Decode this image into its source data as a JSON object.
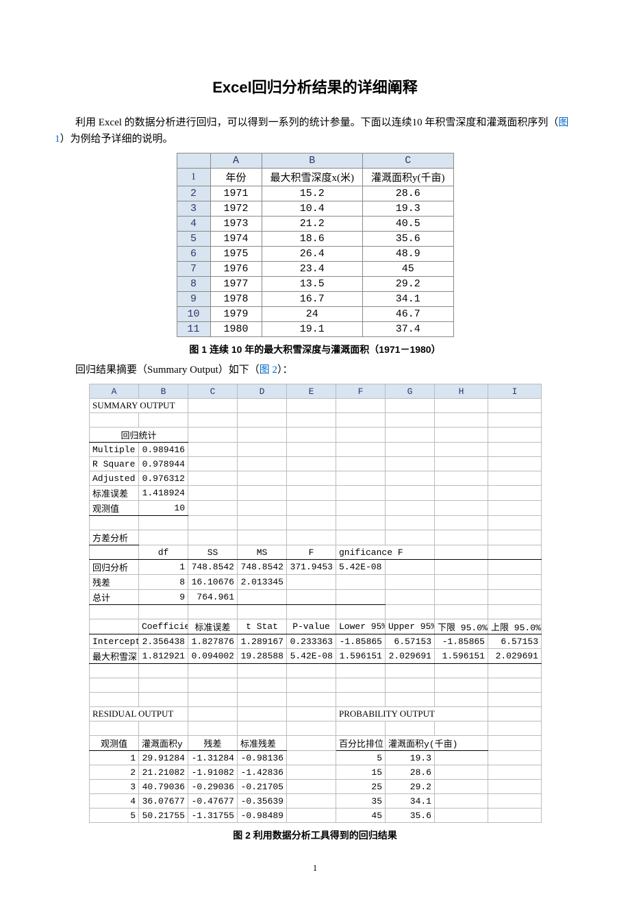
{
  "title": "Excel回归分析结果的详细阐释",
  "intro_pre": "利用 Excel 的数据分析进行回归，可以得到一系列的统计参量。下面以连续10 年积雪深度和灌溉面积序列（",
  "intro_link1": "图 1",
  "intro_post": "）为例给予详细的说明。",
  "table1": {
    "col_letters": [
      "A",
      "B",
      "C"
    ],
    "headers": [
      "年份",
      "最大积雪深度x(米)",
      "灌溉面积y(千亩)"
    ],
    "rows": [
      {
        "n": "1",
        "vals": [
          "年份",
          "最大积雪深度x(米)",
          "灌溉面积y(千亩)"
        ]
      },
      {
        "n": "2",
        "vals": [
          "1971",
          "15.2",
          "28.6"
        ]
      },
      {
        "n": "3",
        "vals": [
          "1972",
          "10.4",
          "19.3"
        ]
      },
      {
        "n": "4",
        "vals": [
          "1973",
          "21.2",
          "40.5"
        ]
      },
      {
        "n": "5",
        "vals": [
          "1974",
          "18.6",
          "35.6"
        ]
      },
      {
        "n": "6",
        "vals": [
          "1975",
          "26.4",
          "48.9"
        ]
      },
      {
        "n": "7",
        "vals": [
          "1976",
          "23.4",
          "45"
        ]
      },
      {
        "n": "8",
        "vals": [
          "1977",
          "13.5",
          "29.2"
        ]
      },
      {
        "n": "9",
        "vals": [
          "1978",
          "16.7",
          "34.1"
        ]
      },
      {
        "n": "10",
        "vals": [
          "1979",
          "24",
          "46.7"
        ]
      },
      {
        "n": "11",
        "vals": [
          "1980",
          "19.1",
          "37.4"
        ]
      }
    ]
  },
  "caption1": "图 1  连续 10 年的最大积雪深度与灌溉面积（1971－1980）",
  "summary_intro_pre": "回归结果摘要（Summary Output）如下（",
  "summary_intro_link": "图 2",
  "summary_intro_post": "）：",
  "sheet_cols": [
    "A",
    "B",
    "C",
    "D",
    "E",
    "F",
    "G",
    "H",
    "I"
  ],
  "summary_title": "SUMMARY OUTPUT",
  "reg_stat_title": "回归统计",
  "reg_stats": [
    {
      "label": "Multiple",
      "val": "0.989416"
    },
    {
      "label": "R Square",
      "val": "0.978944"
    },
    {
      "label": "Adjusted",
      "val": "0.976312"
    },
    {
      "label": "标准误差",
      "val": "1.418924"
    },
    {
      "label": "观测值",
      "val": "10"
    }
  ],
  "anova_title": "方差分析",
  "anova_headers": [
    "",
    "df",
    "SS",
    "MS",
    "F",
    "gnificance F",
    "",
    "",
    ""
  ],
  "anova_rows": [
    {
      "label": "回归分析",
      "df": "1",
      "ss": "748.8542",
      "ms": "748.8542",
      "f": "371.9453",
      "sig": "5.42E-08"
    },
    {
      "label": "残差",
      "df": "8",
      "ss": "16.10676",
      "ms": "2.013345",
      "f": "",
      "sig": ""
    },
    {
      "label": "总计",
      "df": "9",
      "ss": "764.961",
      "ms": "",
      "f": "",
      "sig": ""
    }
  ],
  "coef_headers": [
    "",
    "Coefficien",
    "标准误差",
    "t Stat",
    "P-value",
    "Lower 95%",
    "Upper 95%",
    "下限 95.0%",
    "上限 95.0%"
  ],
  "coef_rows": [
    {
      "label": "Intercept",
      "c": "2.356438",
      "se": "1.827876",
      "t": "1.289167",
      "p": "0.233363",
      "l95": "-1.85865",
      "u95": "6.57153",
      "l95b": "-1.85865",
      "u95b": "6.57153"
    },
    {
      "label": "最大积雪深",
      "c": "1.812921",
      "se": "0.094002",
      "t": "19.28588",
      "p": "5.42E-08",
      "l95": "1.596151",
      "u95": "2.029691",
      "l95b": "1.596151",
      "u95b": "2.029691"
    }
  ],
  "residual_title": "RESIDUAL OUTPUT",
  "probability_title": "PROBABILITY OUTPUT",
  "resid_headers_left": [
    "观测值",
    "灌溉面积y",
    "残差",
    "标准残差"
  ],
  "resid_headers_right": [
    "百分比排位",
    "灌溉面积y(千亩)"
  ],
  "resid_rows": [
    {
      "n": "1",
      "pred": "29.91284",
      "res": "-1.31284",
      "std": "-0.98136",
      "pct": "5",
      "y": "19.3"
    },
    {
      "n": "2",
      "pred": "21.21082",
      "res": "-1.91082",
      "std": "-1.42836",
      "pct": "15",
      "y": "28.6"
    },
    {
      "n": "3",
      "pred": "40.79036",
      "res": "-0.29036",
      "std": "-0.21705",
      "pct": "25",
      "y": "29.2"
    },
    {
      "n": "4",
      "pred": "36.07677",
      "res": "-0.47677",
      "std": "-0.35639",
      "pct": "35",
      "y": "34.1"
    },
    {
      "n": "5",
      "pred": "50.21755",
      "res": "-1.31755",
      "std": "-0.98489",
      "pct": "45",
      "y": "35.6"
    }
  ],
  "caption2": "图 2  利用数据分析工具得到的回归结果",
  "page_num": "1"
}
